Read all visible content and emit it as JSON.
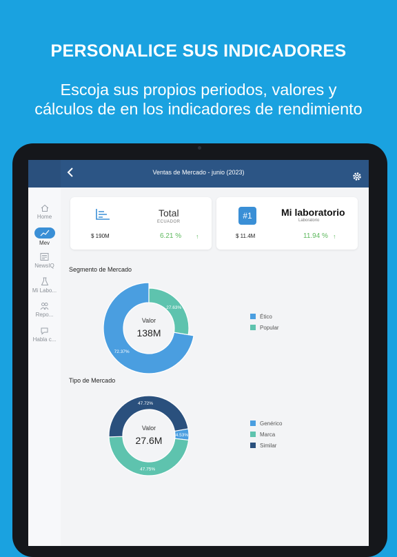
{
  "headline": "PERSONALICE SUS INDICADORES",
  "subline": [
    "Escoja sus propios periodos, valores y",
    "cálculos de en los indicadores de rendimiento"
  ],
  "app": {
    "title": "Ventas de Mercado - junio (2023)",
    "back_icon": "chevron-left-icon",
    "settings_icon": "gear-icon"
  },
  "sidebar": {
    "items": [
      {
        "label": "Home",
        "icon": "home-icon"
      },
      {
        "label": "Mev",
        "icon": "chart-icon",
        "active": true
      },
      {
        "label": "NewsIQ",
        "icon": "newspaper-icon"
      },
      {
        "label": "Mi Labo...",
        "icon": "flask-icon"
      },
      {
        "label": "Repo...",
        "icon": "people-icon"
      },
      {
        "label": "Habla c...",
        "icon": "chat-icon"
      }
    ]
  },
  "cards": {
    "total": {
      "title": "Total",
      "subtitle": "ECUADOR",
      "value": "$ 190M",
      "pct": "6.21 %",
      "arrow": "↑"
    },
    "lab": {
      "badge": "#1",
      "title": "Mi laboratorio",
      "subtitle": "Laboratorio",
      "value": "$ 11.4M",
      "pct": "11.94 %",
      "arrow": "↑"
    }
  },
  "colors": {
    "accent": "#3a8fd6",
    "teal": "#5ec3ae",
    "navy": "#2a507d",
    "positive": "#5cb85c"
  },
  "chart_data": [
    {
      "type": "pie",
      "title": "Segmento de Mercado",
      "center_label": "Valor",
      "center_value": "138M",
      "categories": [
        "Ético",
        "Popular"
      ],
      "values": [
        72.37,
        27.63
      ],
      "labels": [
        "72.37%",
        "27.63%"
      ],
      "colors": [
        "#4a9ee0",
        "#5ec3ae"
      ]
    },
    {
      "type": "pie",
      "title": "Tipo de Mercado",
      "center_label": "Valor",
      "center_value": "27.6M",
      "categories": [
        "Genérico",
        "Marca",
        "Similar"
      ],
      "values": [
        4.53,
        47.75,
        47.72
      ],
      "labels": [
        "4.53%",
        "47.75%",
        "47.72%"
      ],
      "colors": [
        "#4a9ee0",
        "#5ec3ae",
        "#2a507d"
      ]
    }
  ]
}
